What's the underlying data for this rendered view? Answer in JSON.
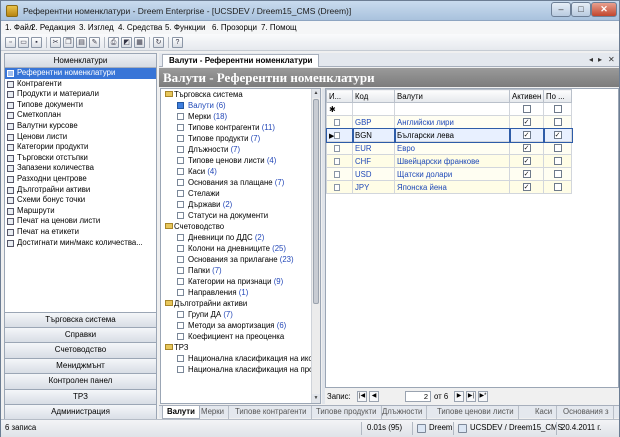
{
  "window": {
    "title": "Референтни номенклатури - Dreem Enterprise - [UCSDEV / Dreem15_CMS (Dreem)]"
  },
  "menu": {
    "items": [
      "1. Файл",
      "2. Редакция",
      "3. Изглед",
      "4. Средства",
      "5. Функции",
      "6. Прозорци",
      "7. Помощ"
    ]
  },
  "toolbar": {
    "icons": [
      "new-icon",
      "open-icon",
      "save-icon",
      "cut-icon",
      "copy-icon",
      "paste-icon",
      "delete-icon",
      "print-icon",
      "preview-icon",
      "export-icon",
      "refresh-icon",
      "help-icon"
    ]
  },
  "left_panel": {
    "header": "Номенклатури",
    "items": [
      "Референтни номенклатури",
      "Контрагенти",
      "Продукти и материали",
      "Типове документи",
      "Сметкоплан",
      "Валутни курсове",
      "Ценови листи",
      "Категории продукти",
      "Търговски отстъпки",
      "Запазени количества",
      "Разходни центрове",
      "Дълготрайни активи",
      "Схеми бонус точки",
      "Маршрути",
      "Печат на ценови листи",
      "Печат на етикети",
      "Достигнати мин/макс количества..."
    ],
    "sections": [
      "Търговска система",
      "Справки",
      "Счетоводство",
      "Мениджмънт",
      "Контролен панел",
      "ТРЗ",
      "Администрация"
    ]
  },
  "document": {
    "tab": "Валути - Референтни номенклатури",
    "banner": "Валути - Референтни номенклатури",
    "strip_controls": [
      "◂",
      "▸",
      "✕"
    ]
  },
  "tree": {
    "nodes": [
      {
        "type": "group",
        "label": "Търговска система",
        "count": ""
      },
      {
        "type": "leaf",
        "label": "Валути",
        "count": "(6)",
        "selected": true
      },
      {
        "type": "leaf",
        "label": "Мерки",
        "count": "(18)"
      },
      {
        "type": "leaf",
        "label": "Типове контрагенти",
        "count": "(11)"
      },
      {
        "type": "leaf",
        "label": "Типове продукти",
        "count": "(7)"
      },
      {
        "type": "leaf",
        "label": "Длъжности",
        "count": "(7)"
      },
      {
        "type": "leaf",
        "label": "Типове ценови листи",
        "count": "(4)"
      },
      {
        "type": "leaf",
        "label": "Каси",
        "count": "(4)"
      },
      {
        "type": "leaf",
        "label": "Основания за плащане",
        "count": "(7)"
      },
      {
        "type": "leaf",
        "label": "Стелажи",
        "count": ""
      },
      {
        "type": "leaf",
        "label": "Държави",
        "count": "(2)"
      },
      {
        "type": "leaf",
        "label": "Статуси на документи",
        "count": ""
      },
      {
        "type": "group",
        "label": "Счетоводство",
        "count": ""
      },
      {
        "type": "leaf",
        "label": "Дневници по ДДС",
        "count": "(2)"
      },
      {
        "type": "leaf",
        "label": "Колони на дневниците",
        "count": "(25)"
      },
      {
        "type": "leaf",
        "label": "Основания за прилагане",
        "count": "(23)"
      },
      {
        "type": "leaf",
        "label": "Папки",
        "count": "(7)"
      },
      {
        "type": "leaf",
        "label": "Категории на признаци",
        "count": "(9)"
      },
      {
        "type": "leaf",
        "label": "Направления",
        "count": "(1)"
      },
      {
        "type": "group",
        "label": "Дълготрайни активи",
        "count": ""
      },
      {
        "type": "leaf",
        "label": "Групи ДА",
        "count": "(7)"
      },
      {
        "type": "leaf",
        "label": "Методи за амортизация",
        "count": "(6)"
      },
      {
        "type": "leaf",
        "label": "Коефициент на преоценка",
        "count": ""
      },
      {
        "type": "group",
        "label": "ТРЗ",
        "count": ""
      },
      {
        "type": "leaf",
        "label": "Национална класификация на ико",
        "count": ""
      },
      {
        "type": "leaf",
        "label": "Национална класификация на про",
        "count": ""
      }
    ]
  },
  "grid": {
    "columns": [
      "И...",
      "Код",
      "Валути",
      "Активен",
      "По ..."
    ],
    "filter_marker": "✱",
    "rows": [
      {
        "code": "GBP",
        "name": "Английски лири",
        "active": true,
        "default": false,
        "current": false
      },
      {
        "code": "BGN",
        "name": "Български лева",
        "active": true,
        "default": true,
        "current": true
      },
      {
        "code": "EUR",
        "name": "Евро",
        "active": true,
        "default": false,
        "current": false
      },
      {
        "code": "CHF",
        "name": "Швейцарски франкове",
        "active": true,
        "default": false,
        "current": false
      },
      {
        "code": "USD",
        "name": "Щатски долари",
        "active": true,
        "default": false,
        "current": false
      },
      {
        "code": "JPY",
        "name": "Японска йена",
        "active": true,
        "default": false,
        "current": false
      }
    ],
    "current_marker": "▶"
  },
  "record_nav": {
    "label": "Запис:",
    "position": "2",
    "of_text": "от 6",
    "buttons": [
      "|◀",
      "◀",
      "▶",
      "▶|",
      "▶*"
    ]
  },
  "bottom_tabs": [
    "Валути",
    "Мерки",
    "Типове контрагенти",
    "Типове продукти",
    "Длъжности",
    "Типове ценови листи",
    "Каси",
    "Основания з"
  ],
  "status": {
    "records": "6 записа",
    "timing": "0.01s (95)",
    "db": "Dreem",
    "connection": "UCSDEV / Dreem15_CMS",
    "date": "20.4.2011 г."
  }
}
